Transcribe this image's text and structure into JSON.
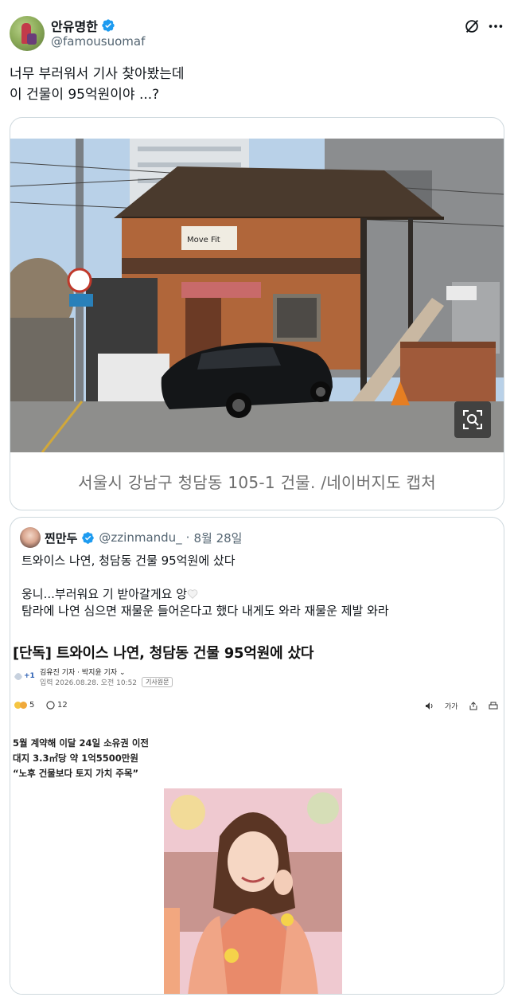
{
  "author": {
    "display_name": "안유명한",
    "handle": "@famousuomaf",
    "verified": true,
    "avatar_icon": "avatar-image"
  },
  "header_icons": [
    "grok-icon",
    "more-icon"
  ],
  "tweet": {
    "lines": [
      "너무 부러워서 기사 찾아봤는데",
      "이 건물이 95억원이야 ...?"
    ]
  },
  "media": {
    "caption": "서울시 강남구 청담동 105-1 건물. /네이버지도 캡처",
    "sign_text": "Move Fit",
    "zoom_icon": "zoom-icon"
  },
  "quote": {
    "display_name": "찐만두",
    "handle": "@zzinmandu_",
    "separator": "·",
    "date": "8월 28일",
    "line1": "트와이스 나연, 청담동 건물 95억원에 샀다",
    "line2": "웅니...부러워요 기 받아갈게요 앙",
    "line3": "탐라에 나연 심으면 재물운 들어온다고 했다 내게도 와라 재물운 제발 와라"
  },
  "article": {
    "title": "[단독] 트와이스 나연, 청담동 건물 95억원에 샀다",
    "logo_text": "+1",
    "reporters": "김유진 기자 · 박지윤 기자",
    "input_date": "입력 2026.08.28. 오전 10:52",
    "original_button": "기사원문",
    "reaction_count": "5",
    "comment_count": "12",
    "tools": [
      "audio-icon",
      "가가",
      "share-icon",
      "print-icon"
    ],
    "tool_font_label": "가가",
    "summary": [
      "5월 계약해 이달 24일 소유권 이전",
      "대지 3.3㎡당 약 1억5500만원",
      "“노후 건물보다 토지 가치 주목”"
    ]
  },
  "colors": {
    "verified_blue": "#1d9bf0",
    "text_primary": "#0f1419",
    "text_secondary": "#536471",
    "border": "#cfd9de",
    "caption_gray": "#6e6e6e"
  }
}
